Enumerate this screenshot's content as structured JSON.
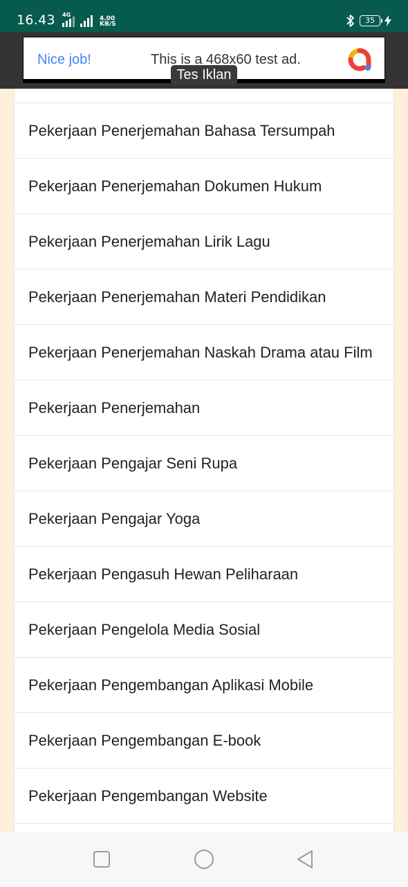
{
  "status_bar": {
    "time": "16.43",
    "network_type": "4G",
    "speed_value": "4.00",
    "speed_unit": "KB/S",
    "battery": "35"
  },
  "ad": {
    "label": "Tes Iklan",
    "headline": "Nice job!",
    "body": "This is a 468x60 test ad."
  },
  "list": {
    "items": [
      "Pekerjaan Penerjemahan Bahasa Tersumpah",
      "Pekerjaan Penerjemahan Dokumen Hukum",
      "Pekerjaan Penerjemahan Lirik Lagu",
      "Pekerjaan Penerjemahan Materi Pendidikan",
      "Pekerjaan Penerjemahan Naskah Drama atau Film",
      "Pekerjaan Penerjemahan",
      "Pekerjaan Pengajar Seni Rupa",
      "Pekerjaan Pengajar Yoga",
      "Pekerjaan Pengasuh Hewan Peliharaan",
      "Pekerjaan Pengelola Media Sosial",
      "Pekerjaan Pengembangan Aplikasi Mobile",
      "Pekerjaan Pengembangan E-book",
      "Pekerjaan Pengembangan Website"
    ]
  },
  "colors": {
    "status_bar": "#075B4E",
    "page_background": "#FDEFD9",
    "ad_headline": "#4285F4"
  }
}
